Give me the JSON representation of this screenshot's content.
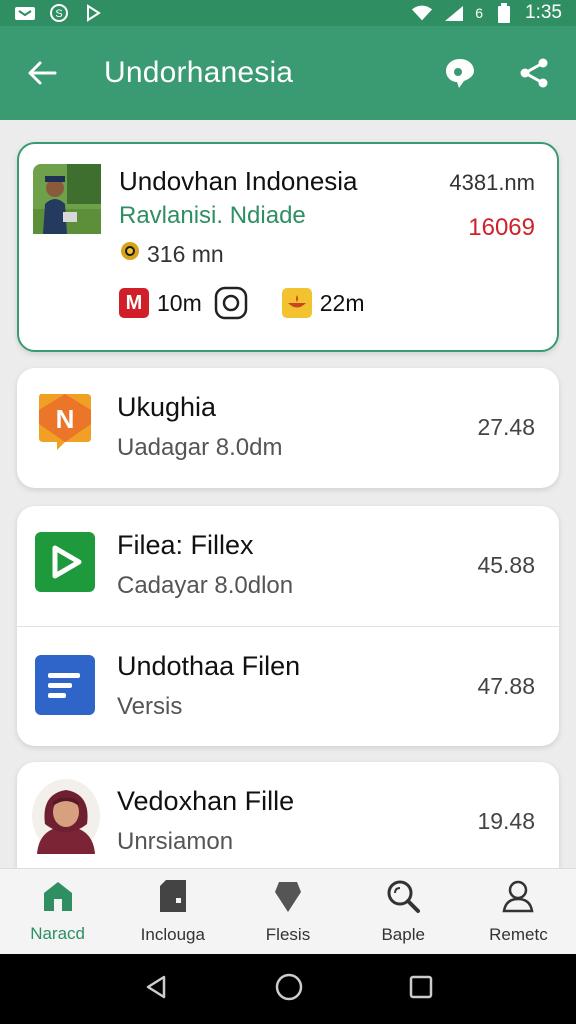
{
  "status_bar": {
    "time": "1:35",
    "network": "6"
  },
  "app_bar": {
    "title": "Undorhanesia"
  },
  "featured": {
    "title": "Undovhan Indonesia",
    "subtitle": "Ravlanisi. Ndiade",
    "meta": "316 mn",
    "time": "4381.nm",
    "count": "16069",
    "badge1_letter": "M",
    "badge1_text": "10m",
    "badge2_text": "22m"
  },
  "items": [
    {
      "title": "Ukughia",
      "subtitle": "Uadagar 8.0dm",
      "value": "27.48"
    },
    {
      "title": "Filea: Fillex",
      "subtitle": "Cadayar 8.0dlon",
      "value": "45.88"
    },
    {
      "title": "Undothaa Filen",
      "subtitle": "Versis",
      "value": "47.88"
    },
    {
      "title": "Vedoxhan Fille",
      "subtitle": "Unrsiamon",
      "value": "19.48"
    }
  ],
  "bottom_nav": [
    {
      "label": "Naracd",
      "active": true
    },
    {
      "label": "Inclouga",
      "active": false
    },
    {
      "label": "Flesis",
      "active": false
    },
    {
      "label": "Baple",
      "active": false
    },
    {
      "label": "Remetc",
      "active": false
    }
  ],
  "colors": {
    "primary": "#3a9a72",
    "status": "#2f8f63",
    "count_red": "#d0202a"
  }
}
